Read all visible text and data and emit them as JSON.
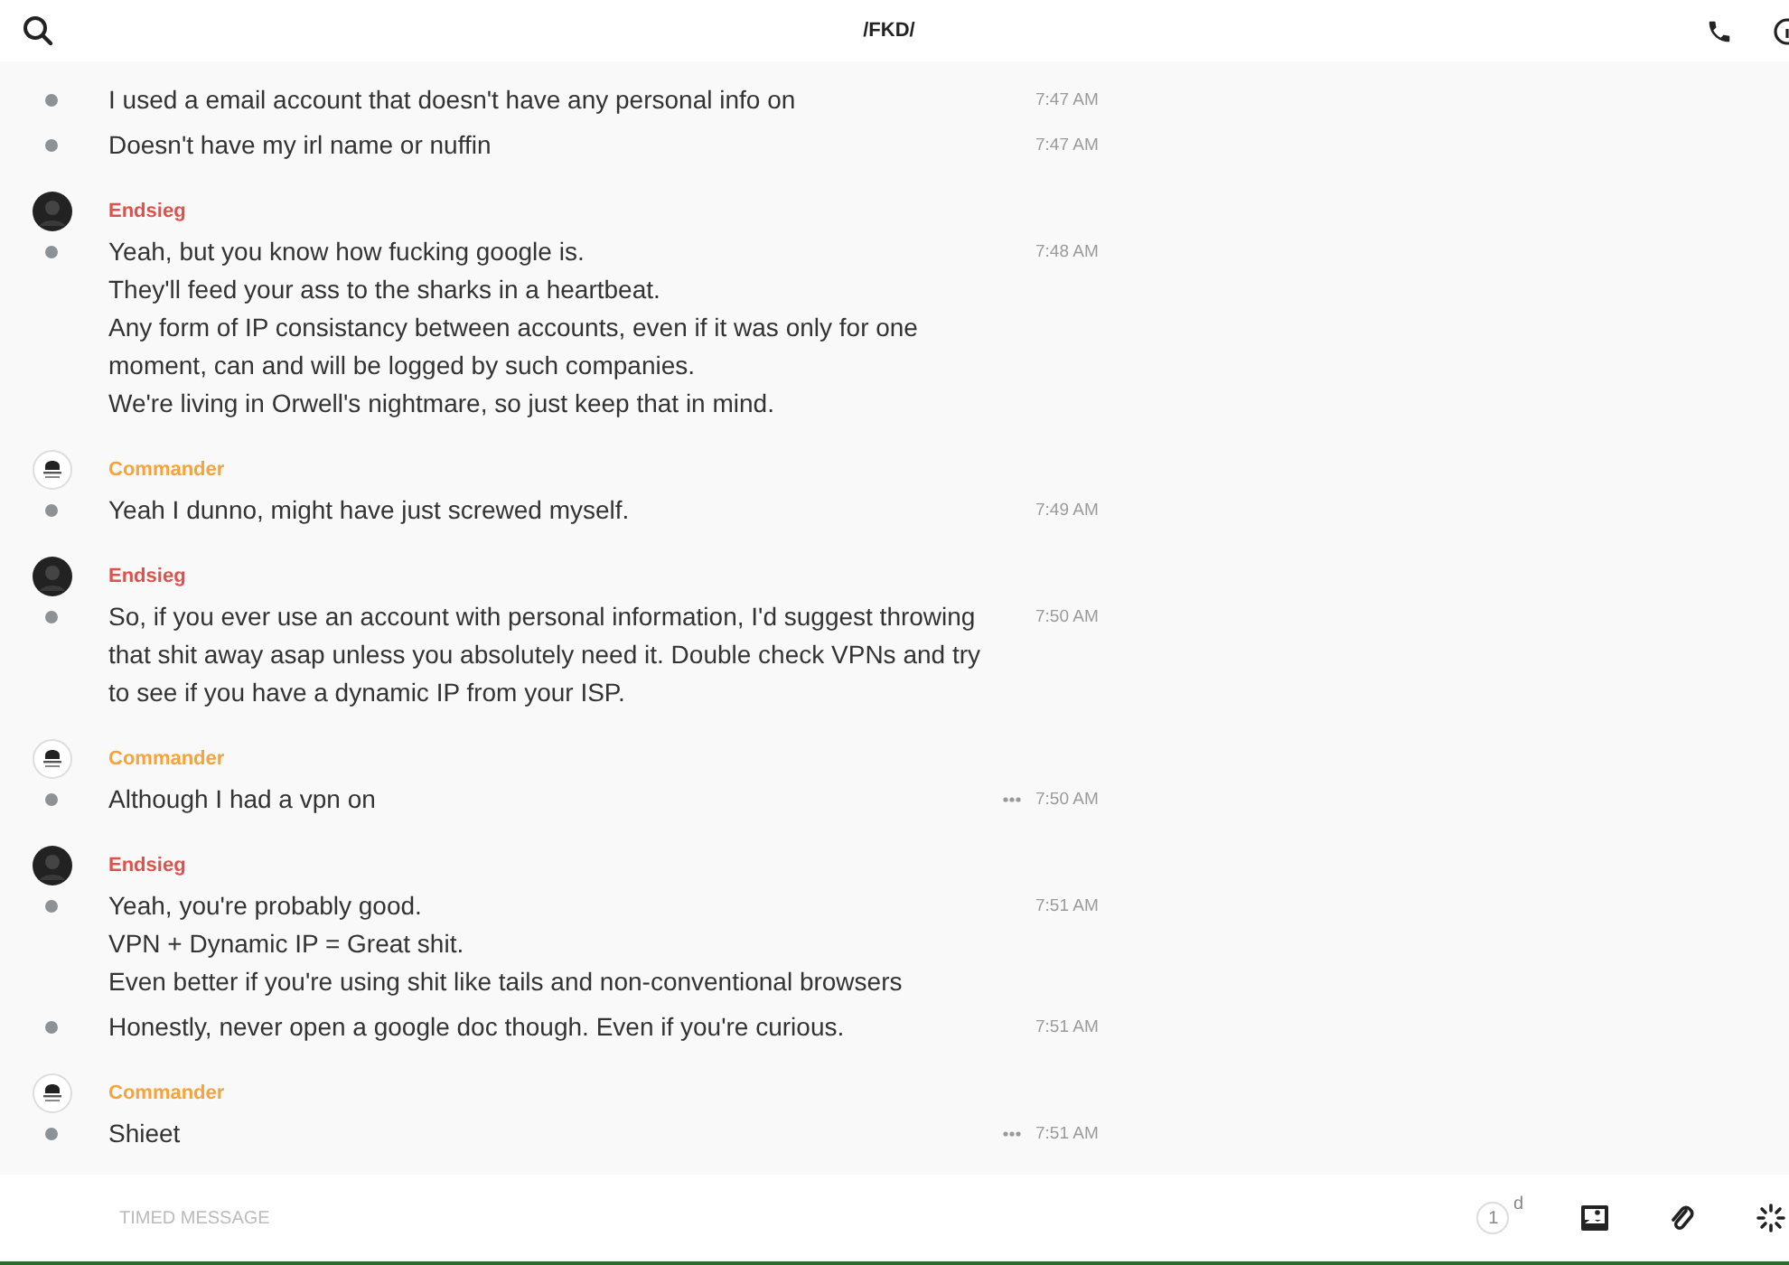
{
  "header": {
    "title": "/FKD/"
  },
  "groups": [
    {
      "messages": [
        {
          "text": "I used a email account that doesn't have any personal info on",
          "time": "7:47 AM",
          "more": false
        },
        {
          "text": "Doesn't have my irl name or nuffin",
          "time": "7:47 AM",
          "more": false
        }
      ]
    },
    {
      "author": {
        "name": "Endsieg",
        "color": "#e0504c",
        "kind": "dark"
      },
      "messages": [
        {
          "text": "Yeah, but you know how fucking google is.\nThey'll feed your ass to the sharks in a heartbeat.\nAny form of IP consistancy between accounts, even if it was only for one moment, can and will be logged by such companies.\nWe're living in Orwell's nightmare, so just keep that in mind.",
          "time": "7:48 AM",
          "more": false
        }
      ]
    },
    {
      "author": {
        "name": "Commander",
        "color": "#f5a33a",
        "kind": "emblem"
      },
      "messages": [
        {
          "text": "Yeah I dunno, might have just screwed myself.",
          "time": "7:49 AM",
          "more": false
        }
      ]
    },
    {
      "author": {
        "name": "Endsieg",
        "color": "#e0504c",
        "kind": "dark"
      },
      "messages": [
        {
          "text": "So, if you ever use an account with personal information, I'd suggest throwing that shit away asap unless you absolutely need it. Double check VPNs and try to see if you have a dynamic IP from your ISP.",
          "time": "7:50 AM",
          "more": false
        }
      ]
    },
    {
      "author": {
        "name": "Commander",
        "color": "#f5a33a",
        "kind": "emblem"
      },
      "messages": [
        {
          "text": "Although I had a vpn on",
          "time": "7:50 AM",
          "more": true
        }
      ]
    },
    {
      "author": {
        "name": "Endsieg",
        "color": "#e0504c",
        "kind": "dark"
      },
      "messages": [
        {
          "text": "Yeah, you're probably good.\nVPN + Dynamic IP = Great shit.\nEven better if you're using shit like tails and non-conventional browsers",
          "time": "7:51 AM",
          "more": false
        },
        {
          "text": "Honestly, never open a google doc though. Even if you're curious.",
          "time": "7:51 AM",
          "more": false
        }
      ]
    },
    {
      "author": {
        "name": "Commander",
        "color": "#f5a33a",
        "kind": "emblem"
      },
      "messages": [
        {
          "text": "Shieet",
          "time": "7:51 AM",
          "more": true
        }
      ]
    }
  ],
  "composer": {
    "placeholder": "TIMED MESSAGE",
    "timer": "1",
    "timer_unit": "d"
  }
}
